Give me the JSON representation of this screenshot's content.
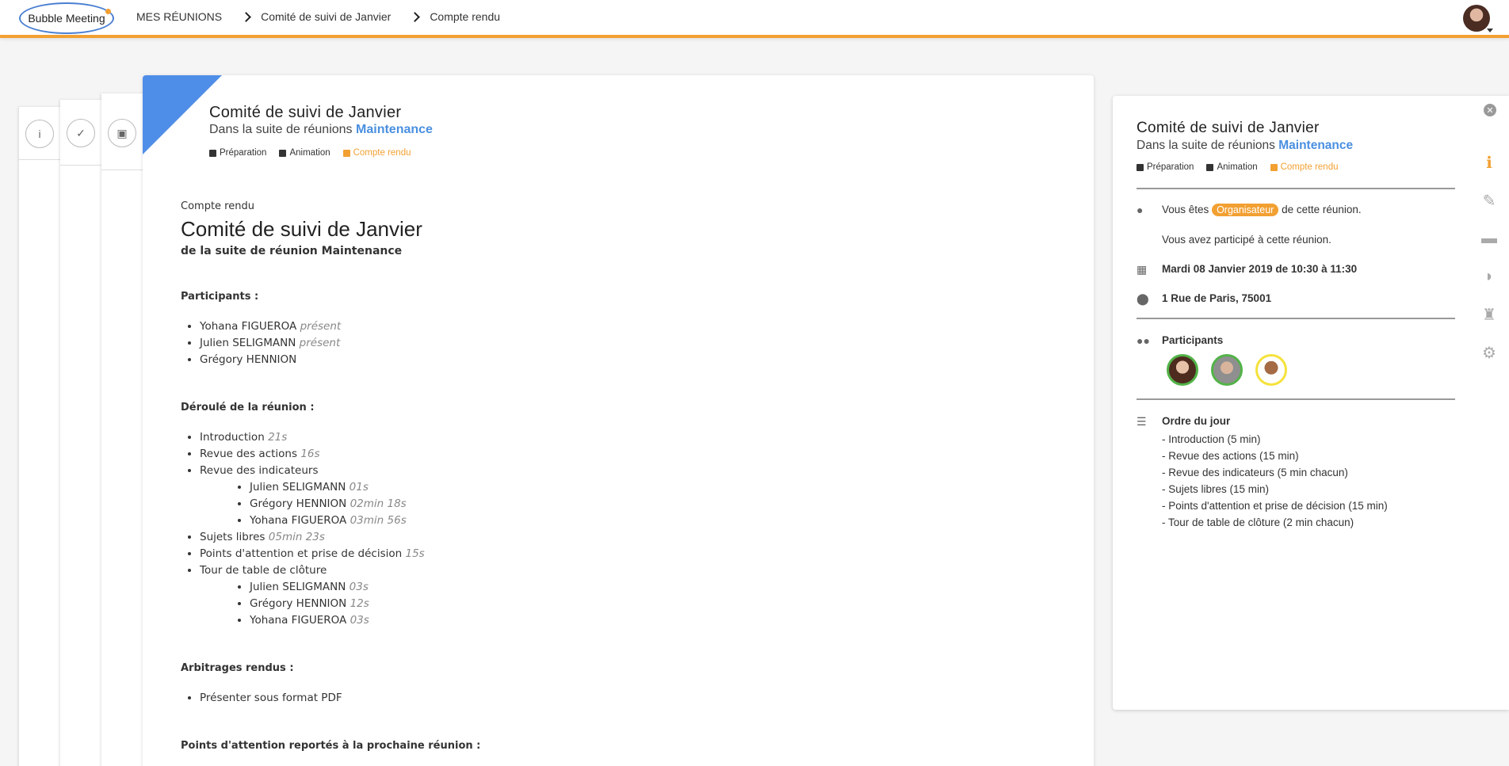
{
  "header": {
    "logo": "Bubble Meeting",
    "breadcrumbs": [
      "MES RÉUNIONS",
      "Comité de suivi de Janvier",
      "Compte rendu"
    ]
  },
  "colors": {
    "accent": "#f2a032",
    "blue": "#4f8ee8",
    "present": "#52b348"
  },
  "main": {
    "title": "Comité de suivi de Janvier",
    "sub_prefix": "Dans la suite de réunions",
    "series": "Maintenance",
    "phases": [
      "Préparation",
      "Animation",
      "Compte rendu"
    ],
    "doc": {
      "label": "Compte rendu",
      "title": "Comité de suivi de Janvier",
      "subtitle": "de la suite de réunion Maintenance",
      "participants_h": "Participants :",
      "participants": [
        {
          "name": "Yohana FIGUEROA",
          "status": "présent"
        },
        {
          "name": "Julien SELIGMANN",
          "status": "présent"
        },
        {
          "name": "Grégory HENNION",
          "status": ""
        }
      ],
      "deroule_h": "Déroulé de la réunion :",
      "items": {
        "intro": {
          "label": "Introduction",
          "dur": "21s"
        },
        "actions": {
          "label": "Revue des actions",
          "dur": "16s"
        },
        "indicateurs": {
          "label": "Revue des indicateurs"
        },
        "ind_sub": [
          {
            "label": "Julien SELIGMANN",
            "dur": "01s"
          },
          {
            "label": "Grégory HENNION",
            "dur": "02min 18s"
          },
          {
            "label": "Yohana FIGUEROA",
            "dur": "03min 56s"
          }
        ],
        "sujets": {
          "label": "Sujets libres",
          "dur": "05min 23s"
        },
        "points": {
          "label": "Points d'attention et prise de décision",
          "dur": "15s"
        },
        "tour": {
          "label": "Tour de table de clôture"
        },
        "tour_sub": [
          {
            "label": "Julien SELIGMANN",
            "dur": "03s"
          },
          {
            "label": "Grégory HENNION",
            "dur": "12s"
          },
          {
            "label": "Yohana FIGUEROA",
            "dur": "03s"
          }
        ]
      },
      "arbitrages_h": "Arbitrages rendus :",
      "arbitrages": [
        "Présenter sous format PDF"
      ],
      "reportes_h": "Points d'attention reportés à la prochaine réunion :"
    }
  },
  "side": {
    "title": "Comité de suivi de Janvier",
    "sub_prefix": "Dans la suite de réunions",
    "series": "Maintenance",
    "phases": [
      "Préparation",
      "Animation",
      "Compte rendu"
    ],
    "role_prefix": "Vous êtes",
    "role": "Organisateur",
    "role_suffix": "de cette réunion.",
    "participated": "Vous avez participé à cette réunion.",
    "date": "Mardi 08 Janvier 2019 de 10:30 à 11:30",
    "address": "1 Rue de Paris, 75001",
    "participants_label": "Participants",
    "agenda_label": "Ordre du jour",
    "agenda": [
      "- Introduction (5 min)",
      "- Revue des actions (15 min)",
      "- Revue des indicateurs (5 min chacun)",
      "- Sujets libres (15 min)",
      "- Points d'attention et prise de décision (15 min)",
      "- Tour de table de clôture (2 min chacun)"
    ]
  },
  "icons": [
    "info-icon",
    "checklist-icon",
    "presentation-icon",
    "close-icon",
    "signature-icon",
    "folder-icon",
    "chat-icon",
    "spy-icon",
    "gear-icon",
    "user-icon",
    "calendar-icon",
    "pin-icon",
    "users-icon",
    "list-icon"
  ]
}
